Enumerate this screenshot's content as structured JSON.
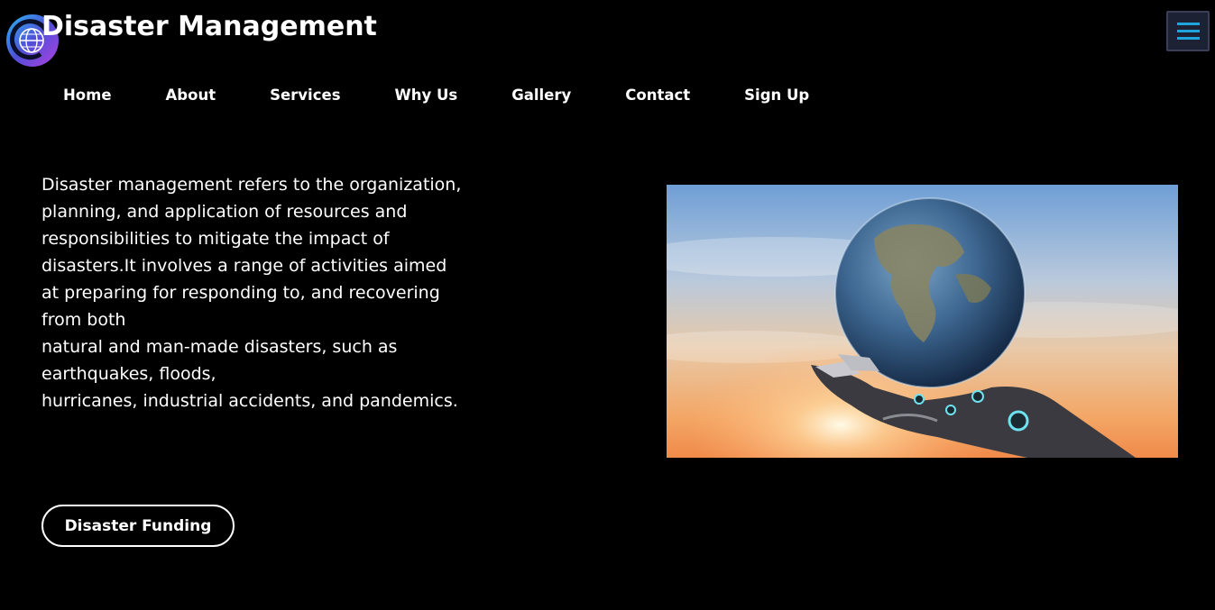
{
  "header": {
    "title": "Disaster Management",
    "logo_icon": "globe-logo-icon",
    "menu_icon": "hamburger-menu-icon"
  },
  "nav": {
    "items": [
      "Home",
      "About",
      "Services",
      "Why Us",
      "Gallery",
      "Contact",
      "Sign Up"
    ]
  },
  "hero": {
    "lines": [
      "Disaster management refers to the organization, planning, and application of resources and responsibilities to mitigate the impact of disasters.It involves a range of activities aimed",
      "at preparing for responding to, and recovering from both",
      "natural and man-made disasters, such as earthquakes, floods,",
      "hurricanes, industrial accidents, and pandemics."
    ],
    "cta_label": "Disaster Funding",
    "image_subject": "robotic hand holding earth globe at sunset"
  },
  "colors": {
    "background": "#000000",
    "text": "#ffffff",
    "menu_accent": "#1fa4dc",
    "menu_bg": "#1d2134"
  }
}
